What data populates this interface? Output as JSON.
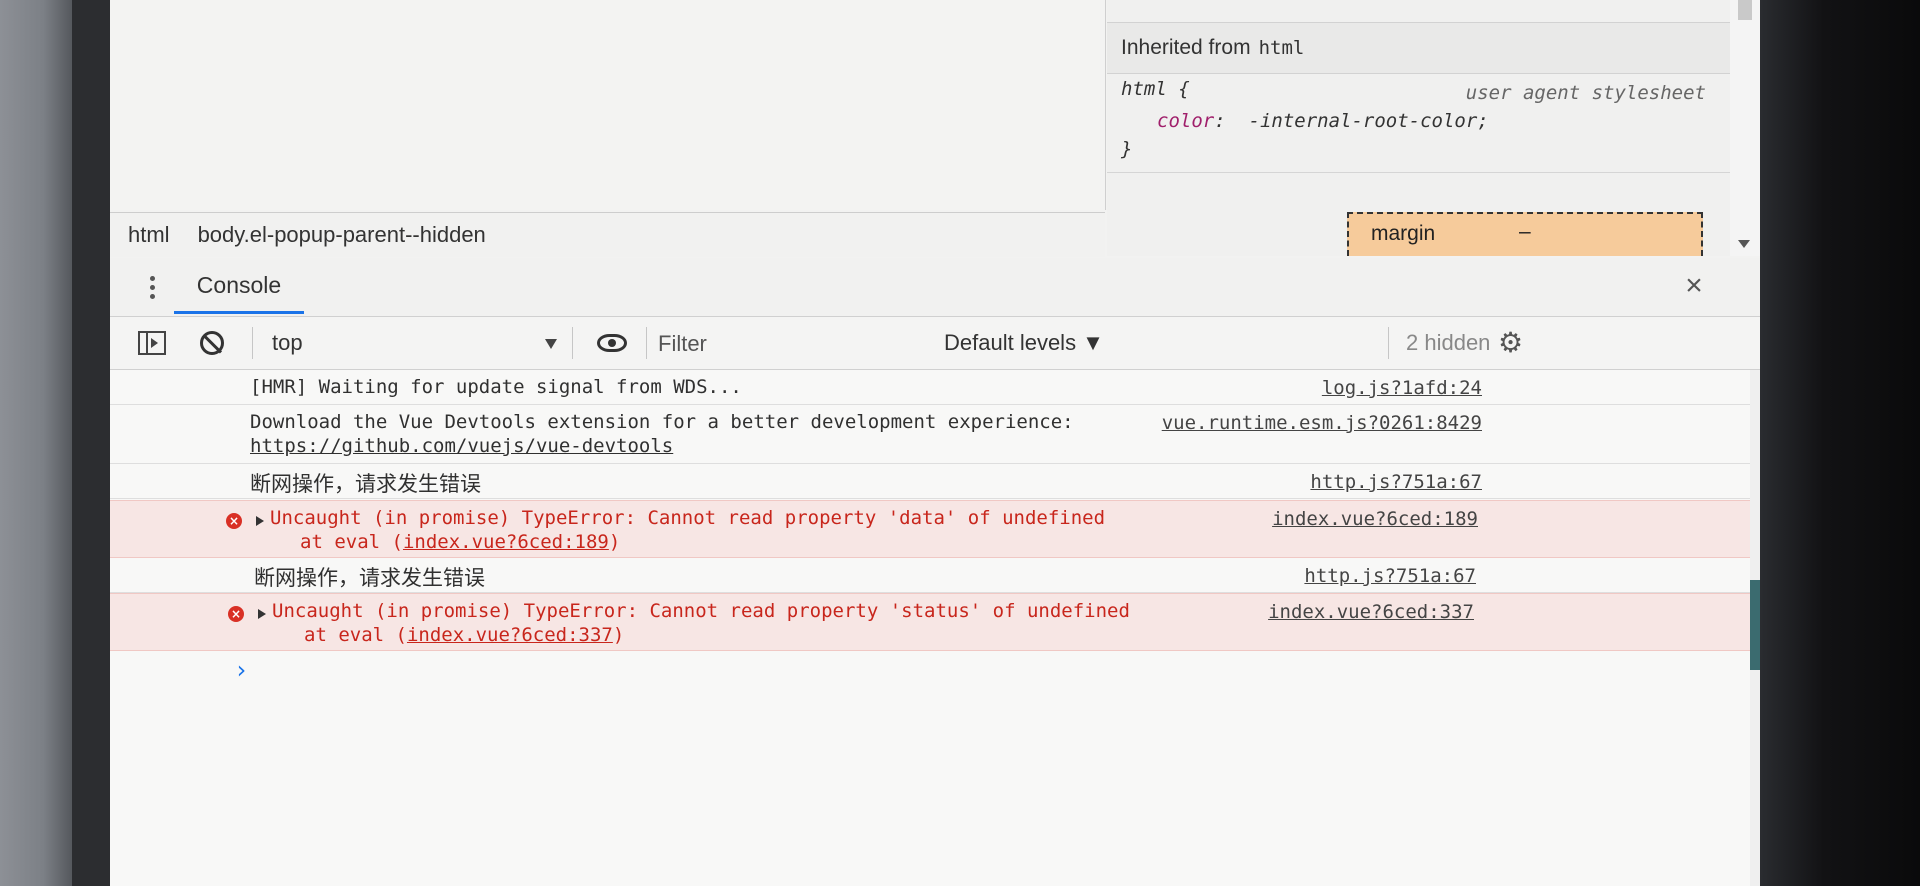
{
  "elements_panel": {
    "breadcrumb": [
      "html",
      "body.el-popup-parent--hidden"
    ]
  },
  "styles_panel": {
    "inherited_label": "Inherited from",
    "inherited_element": "html",
    "rule_selector": "html {",
    "rule_source": "user agent stylesheet",
    "rule_property": "color",
    "rule_value": "-internal-root-color;",
    "rule_close": "}",
    "box_model_label": "margin",
    "box_model_value": "–"
  },
  "drawer": {
    "tab_label": "Console",
    "close_symbol": "×"
  },
  "toolbar": {
    "context": "top",
    "filter_placeholder": "Filter",
    "levels": "Default levels ▼",
    "hidden": "2 hidden"
  },
  "messages": [
    {
      "text": "[HMR] Waiting for update signal from WDS...",
      "source": "log.js?1afd:24"
    },
    {
      "text": "Download the Vue Devtools extension for a better development experience:",
      "link": "https://github.com/vuejs/vue-devtools",
      "source": "vue.runtime.esm.js?0261:8429"
    },
    {
      "text": "断网操作，请求发生错误",
      "source": "http.js?751a:67"
    },
    {
      "text": "Uncaught (in promise) TypeError: Cannot read property 'data' of undefined",
      "trace_prefix": "at eval (",
      "trace_link": "index.vue?6ced:189",
      "trace_suffix": ")",
      "source": "index.vue?6ced:189"
    },
    {
      "text": "断网操作，请求发生错误",
      "source": "http.js?751a:67"
    },
    {
      "text": "Uncaught (in promise) TypeError: Cannot read property 'status' of undefined",
      "trace_prefix": "at eval (",
      "trace_link": "index.vue?6ced:337",
      "trace_suffix": ")",
      "source": "index.vue?6ced:337"
    }
  ],
  "prompt_symbol": "›",
  "icons": {
    "error": "error-circle-icon",
    "expand": "triangle-right-icon"
  }
}
